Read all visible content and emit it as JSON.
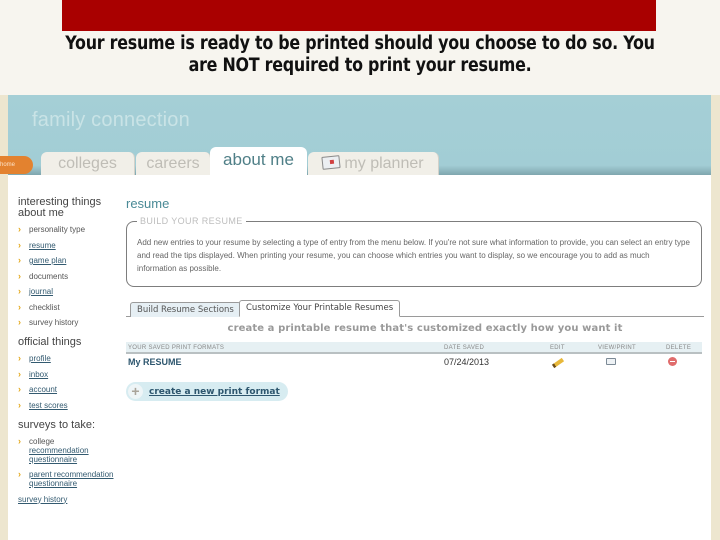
{
  "slide": {
    "headline": "Your resume is ready to be printed should you choose to do so.  You are NOT required to print your resume.",
    "accent_color": "#a90000"
  },
  "app": {
    "brand": "family connection",
    "home_badge": "home",
    "tabs": [
      {
        "label": "colleges",
        "active": false
      },
      {
        "label": "careers",
        "active": false
      },
      {
        "label": "about me",
        "active": true
      },
      {
        "label": "my planner",
        "active": false,
        "icon": "planner-icon"
      }
    ]
  },
  "sidebar": {
    "sections": [
      {
        "heading": "interesting things about me",
        "items": [
          {
            "label": "personality type",
            "link": false
          },
          {
            "label": "resume",
            "link": true
          },
          {
            "label": "game plan",
            "link": true
          },
          {
            "label": "documents",
            "link": false
          },
          {
            "label": "journal",
            "link": true
          },
          {
            "label": "checklist",
            "link": false
          },
          {
            "label": "survey history",
            "link": false
          }
        ]
      },
      {
        "heading": "official things",
        "items": [
          {
            "label": "profile",
            "link": true
          },
          {
            "label": "inbox",
            "link": true
          },
          {
            "label": "account",
            "link": true
          },
          {
            "label": "test scores",
            "link": true
          }
        ]
      },
      {
        "heading": "surveys to take:",
        "items": [
          {
            "label_plain": "college",
            "label_link": "recommendation questionnaire"
          },
          {
            "label_link_full": "parent recommendation questionnaire"
          }
        ],
        "footer_link": "survey history"
      }
    ]
  },
  "main": {
    "title": "resume",
    "build_box": {
      "legend": "BUILD YOUR RESUME",
      "text": "Add new entries to your resume by selecting a type of entry from the menu below. If you're not sure what information to provide, you can select an entry type and read the tips displayed. When printing your resume, you can choose which entries you want to display, so we encourage you to add as much information as possible."
    },
    "subtabs": [
      {
        "label": "Build Resume Sections",
        "active": false
      },
      {
        "label": "Customize Your Printable Resumes",
        "active": true
      }
    ],
    "subheading": "create a printable resume that's customized exactly how you want it",
    "table": {
      "columns": [
        "YOUR SAVED PRINT FORMATS",
        "DATE SAVED",
        "EDIT",
        "VIEW/PRINT",
        "DELETE"
      ],
      "rows": [
        {
          "name": "My RESUME",
          "date": "07/24/2013",
          "edit": "pencil-icon",
          "view": "printer-icon",
          "delete": "delete-icon"
        }
      ]
    },
    "create_button": "create a new print format"
  }
}
